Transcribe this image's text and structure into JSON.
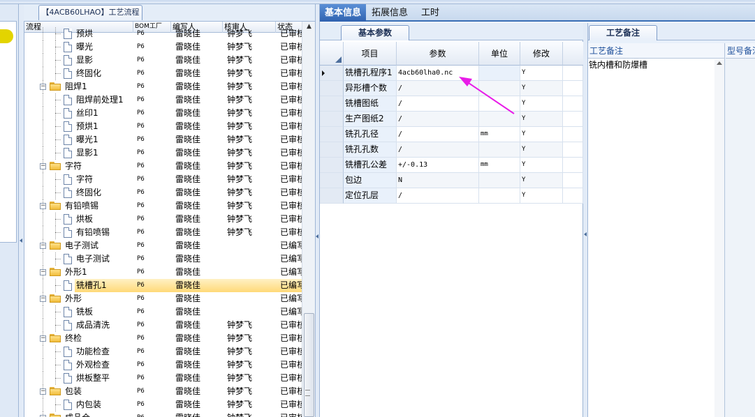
{
  "flow_tab": {
    "label": "【4ACB60LHAO】工艺流程"
  },
  "tree": {
    "headers": {
      "flow": "流程",
      "bom": "BOM工厂",
      "author": "编写人",
      "reviewer": "核审人",
      "status": "状态"
    },
    "rows": [
      {
        "label": "预烘",
        "kind": "doc",
        "level": 2,
        "bom": "P6",
        "author": "雷晓佳",
        "reviewer": "钟梦飞",
        "status": "已审核"
      },
      {
        "label": "曝光",
        "kind": "doc",
        "level": 2,
        "bom": "P6",
        "author": "雷晓佳",
        "reviewer": "钟梦飞",
        "status": "已审核"
      },
      {
        "label": "显影",
        "kind": "doc",
        "level": 2,
        "bom": "P6",
        "author": "雷晓佳",
        "reviewer": "钟梦飞",
        "status": "已审核"
      },
      {
        "label": "终固化",
        "kind": "doc",
        "level": 2,
        "bom": "P6",
        "author": "雷晓佳",
        "reviewer": "钟梦飞",
        "status": "已审核"
      },
      {
        "label": "阻焊1",
        "kind": "folder",
        "level": 1,
        "bom": "P6",
        "author": "雷晓佳",
        "reviewer": "钟梦飞",
        "status": "已审核"
      },
      {
        "label": "阻焊前处理1",
        "kind": "doc",
        "level": 2,
        "bom": "P6",
        "author": "雷晓佳",
        "reviewer": "钟梦飞",
        "status": "已审核"
      },
      {
        "label": "丝印1",
        "kind": "doc",
        "level": 2,
        "bom": "P6",
        "author": "雷晓佳",
        "reviewer": "钟梦飞",
        "status": "已审核"
      },
      {
        "label": "预烘1",
        "kind": "doc",
        "level": 2,
        "bom": "P6",
        "author": "雷晓佳",
        "reviewer": "钟梦飞",
        "status": "已审核"
      },
      {
        "label": "曝光1",
        "kind": "doc",
        "level": 2,
        "bom": "P6",
        "author": "雷晓佳",
        "reviewer": "钟梦飞",
        "status": "已审核"
      },
      {
        "label": "显影1",
        "kind": "doc",
        "level": 2,
        "bom": "P6",
        "author": "雷晓佳",
        "reviewer": "钟梦飞",
        "status": "已审核"
      },
      {
        "label": "字符",
        "kind": "folder",
        "level": 1,
        "bom": "P6",
        "author": "雷晓佳",
        "reviewer": "钟梦飞",
        "status": "已审核"
      },
      {
        "label": "字符",
        "kind": "doc",
        "level": 2,
        "bom": "P6",
        "author": "雷晓佳",
        "reviewer": "钟梦飞",
        "status": "已审核"
      },
      {
        "label": "终固化",
        "kind": "doc",
        "level": 2,
        "bom": "P6",
        "author": "雷晓佳",
        "reviewer": "钟梦飞",
        "status": "已审核"
      },
      {
        "label": "有铅喷锡",
        "kind": "folder",
        "level": 1,
        "bom": "P6",
        "author": "雷晓佳",
        "reviewer": "钟梦飞",
        "status": "已审核"
      },
      {
        "label": "烘板",
        "kind": "doc",
        "level": 2,
        "bom": "P6",
        "author": "雷晓佳",
        "reviewer": "钟梦飞",
        "status": "已审核"
      },
      {
        "label": "有铅喷锡",
        "kind": "doc",
        "level": 2,
        "bom": "P6",
        "author": "雷晓佳",
        "reviewer": "钟梦飞",
        "status": "已审核"
      },
      {
        "label": "电子测试",
        "kind": "folder",
        "level": 1,
        "bom": "P6",
        "author": "雷晓佳",
        "reviewer": "",
        "status": "已编写"
      },
      {
        "label": "电子测试",
        "kind": "doc",
        "level": 2,
        "bom": "P6",
        "author": "雷晓佳",
        "reviewer": "",
        "status": "已编写"
      },
      {
        "label": "外形1",
        "kind": "folder",
        "level": 1,
        "bom": "P6",
        "author": "雷晓佳",
        "reviewer": "",
        "status": "已编写"
      },
      {
        "label": "铣槽孔1",
        "kind": "doc",
        "level": 2,
        "bom": "P6",
        "author": "雷晓佳",
        "reviewer": "",
        "status": "已编写",
        "selected": true
      },
      {
        "label": "外形",
        "kind": "folder",
        "level": 1,
        "bom": "P6",
        "author": "雷晓佳",
        "reviewer": "",
        "status": "已编写"
      },
      {
        "label": "铣板",
        "kind": "doc",
        "level": 2,
        "bom": "P6",
        "author": "雷晓佳",
        "reviewer": "",
        "status": "已编写"
      },
      {
        "label": "成品清洗",
        "kind": "doc",
        "level": 2,
        "bom": "P6",
        "author": "雷晓佳",
        "reviewer": "钟梦飞",
        "status": "已审核"
      },
      {
        "label": "终检",
        "kind": "folder",
        "level": 1,
        "bom": "P6",
        "author": "雷晓佳",
        "reviewer": "钟梦飞",
        "status": "已审核"
      },
      {
        "label": "功能检查",
        "kind": "doc",
        "level": 2,
        "bom": "P6",
        "author": "雷晓佳",
        "reviewer": "钟梦飞",
        "status": "已审核"
      },
      {
        "label": "外观检查",
        "kind": "doc",
        "level": 2,
        "bom": "P6",
        "author": "雷晓佳",
        "reviewer": "钟梦飞",
        "status": "已审核"
      },
      {
        "label": "烘板整平",
        "kind": "doc",
        "level": 2,
        "bom": "P6",
        "author": "雷晓佳",
        "reviewer": "钟梦飞",
        "status": "已审核"
      },
      {
        "label": "包装",
        "kind": "folder",
        "level": 1,
        "bom": "P6",
        "author": "雷晓佳",
        "reviewer": "钟梦飞",
        "status": "已审核"
      },
      {
        "label": "内包装",
        "kind": "doc",
        "level": 2,
        "bom": "P6",
        "author": "雷晓佳",
        "reviewer": "钟梦飞",
        "status": "已审核"
      },
      {
        "label": "成品仓",
        "kind": "folder",
        "level": 1,
        "bom": "P6",
        "author": "雷晓佳",
        "reviewer": "钟梦飞",
        "status": "已审核"
      }
    ]
  },
  "top_tabs": [
    {
      "label": "基本信息",
      "active": true
    },
    {
      "label": "拓展信息",
      "active": false
    },
    {
      "label": "工时",
      "active": false
    }
  ],
  "basic_params": {
    "tab_label": "基本参数",
    "headers": {
      "item": "项目",
      "param": "参数",
      "unit": "单位",
      "modify": "修改"
    },
    "rows": [
      {
        "item": "铣槽孔程序1",
        "param": "4acb60lha0.nc",
        "unit": "",
        "modify": "Y",
        "current": true
      },
      {
        "item": "异形槽个数",
        "param": "/",
        "unit": "",
        "modify": "Y"
      },
      {
        "item": "铣槽图纸",
        "param": "/",
        "unit": "",
        "modify": "Y"
      },
      {
        "item": "生产图纸2",
        "param": "/",
        "unit": "",
        "modify": "Y"
      },
      {
        "item": "铣孔孔径",
        "param": "/",
        "unit": "mm",
        "modify": "Y"
      },
      {
        "item": "铣孔孔数",
        "param": "/",
        "unit": "",
        "modify": "Y"
      },
      {
        "item": "铣槽孔公差",
        "param": "+/-0.13",
        "unit": "mm",
        "modify": "Y"
      },
      {
        "item": "包边",
        "param": "N",
        "unit": "",
        "modify": "Y"
      },
      {
        "item": "定位孔层",
        "param": "/",
        "unit": "",
        "modify": "Y"
      }
    ]
  },
  "remarks": {
    "tab_label": "工艺备注",
    "col1": "工艺备注",
    "col2": "型号备注",
    "text": "铣内槽和防爆槽"
  },
  "colors": {
    "accent_blue": "#2f62b0",
    "selection": "#ffd978",
    "annotation_arrow": "#e81ce8"
  }
}
